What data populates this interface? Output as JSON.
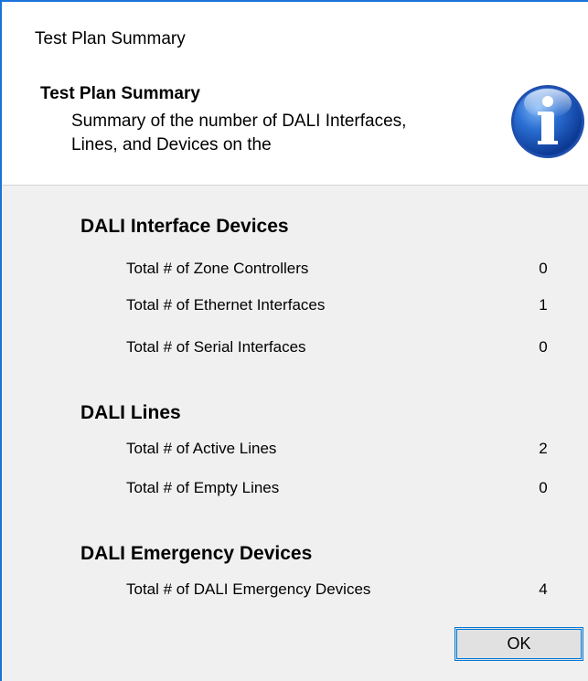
{
  "window": {
    "title": "Test Plan Summary"
  },
  "header": {
    "title": "Test Plan Summary",
    "description": "Summary of the number of DALI Interfaces, Lines, and Devices on the",
    "icon": "info-icon"
  },
  "sections": [
    {
      "title": "DALI Interface Devices",
      "rows": [
        {
          "label": "Total # of Zone Controllers",
          "value": "0"
        },
        {
          "label": "Total # of Ethernet Interfaces",
          "value": "1"
        },
        {
          "label": "Total # of Serial Interfaces",
          "value": "0"
        }
      ]
    },
    {
      "title": "DALI Lines",
      "rows": [
        {
          "label": "Total # of Active Lines",
          "value": "2"
        },
        {
          "label": "Total # of Empty Lines",
          "value": "0"
        }
      ]
    },
    {
      "title": "DALI Emergency Devices",
      "rows": [
        {
          "label": "Total # of DALI Emergency Devices",
          "value": "4"
        }
      ]
    }
  ],
  "buttons": {
    "ok_label": "OK"
  },
  "colors": {
    "window_border": "#1a73d9",
    "content_background": "#f0f0f0",
    "header_background": "#ffffff",
    "button_focus": "#0078d7"
  }
}
